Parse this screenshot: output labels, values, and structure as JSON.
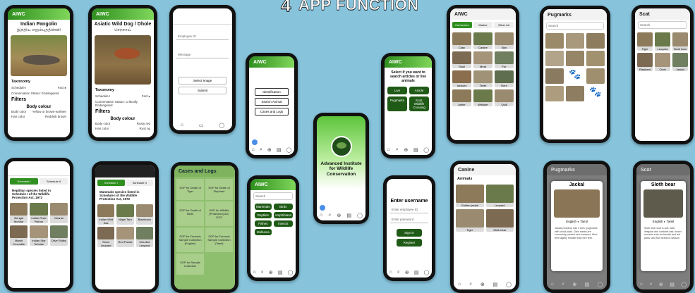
{
  "slide_title": {
    "number": "4",
    "text": "APP FUNCTION"
  },
  "app_name": "AIWC",
  "pangolin": {
    "name": "Indian Pangolin",
    "local_name": "இந்திய எறும்புத்தின்னி",
    "section": "Taxonomy",
    "rows": [
      [
        "Schedule I",
        "Fact ▸"
      ],
      [
        "Conservation Status: Endangered",
        ""
      ]
    ],
    "filters": "Filters",
    "body_colour": "Body colour",
    "attrs": [
      [
        "Body color",
        "Yellow or brown-earthen"
      ],
      [
        "Hair color",
        "Reddish brown"
      ]
    ]
  },
  "dhole": {
    "name": "Asiatic Wild Dog / Dhole",
    "local_name": "செந்நாய்",
    "section": "Taxonomy",
    "rows": [
      [
        "Schedule I",
        "Fact ▸"
      ],
      [
        "Conservation Status: Critically Endangered",
        ""
      ]
    ],
    "filters": "Filters",
    "body_colour": "Body colour",
    "attrs": [
      [
        "Body color",
        "Rusty red"
      ],
      [
        "Hair color",
        "Rust ng"
      ]
    ]
  },
  "report": {
    "fields": [
      "Employee ID",
      "Message"
    ],
    "buttons": [
      "Select Image",
      "Submit"
    ]
  },
  "menu": {
    "buttons": [
      "Identification",
      "Search Animal",
      "Cases and Logs"
    ]
  },
  "search_choice": {
    "prompt": "Select if you want to search articles or live animals",
    "buttons": [
      "Live",
      "Article",
      "Pugmarks",
      "Scat, Wildlife Crossing"
    ]
  },
  "splash": {
    "title": "Advanced Institute for Wildlife Conservation"
  },
  "article_grid": {
    "tabs": [
      "Carnivores",
      "Marine",
      "Other Art"
    ],
    "items": [
      "Claw",
      "Canine",
      "Skin",
      "Skull",
      "Meat",
      "Fur",
      "Incisors",
      "Teeth",
      "Horn",
      "Antler",
      "Whisker",
      "Quill"
    ]
  },
  "pugmarks": {
    "title": "Pugmarks",
    "search": "Search"
  },
  "scat": {
    "title": "Scat",
    "search": "Search",
    "items": [
      "Tiger",
      "Leopard",
      "Sloth bear",
      "Elephant",
      "Civet",
      "Jackal"
    ]
  },
  "schedule_list": {
    "tabs": [
      "Schedule I",
      "Schedule II"
    ],
    "header": "Reptilian species listed in Schedule I of the Wildlife Protection Act, 1972",
    "items": [
      "Bengal Monitor",
      "Indian Rock Python",
      "Gharial",
      "Marsh Crocodile",
      "Indian Star Tortoise",
      "Olive Ridley"
    ]
  },
  "mammal_list": {
    "tabs": [
      "Schedule I",
      "Schedule II"
    ],
    "header": "Mammals species listed in Schedule I of the Wildlife Protection Act, 1972",
    "items": [
      "Indian Wild Ass",
      "Nilgiri Tahr",
      "Blackbuck",
      "Snow Leopard",
      "Red Panda",
      "Clouded Leopard"
    ]
  },
  "cases": {
    "title": "Cases and Logs",
    "cells": [
      "SOP for Death of Tiger",
      "SOP for Death of Elephant",
      "SOP for Death of Birds",
      "SOP for Wildlife (Protection) Act, 2022",
      "SOP for Forensic Sample Collection (English)",
      "SOP for Forensic Sample Collection (Tamil)",
      "SOP for Sample Collection"
    ]
  },
  "category_list": {
    "search": "Search",
    "items": [
      "Mammals",
      "Birds",
      "Reptiles",
      "Amphibians",
      "Fishes",
      "Insects",
      "Mollusca"
    ]
  },
  "login": {
    "title": "Enter username",
    "fields": [
      "Enter employee ID",
      "Enter password"
    ],
    "buttons": [
      "Sign in",
      "Register"
    ]
  },
  "canine": {
    "title": "Canine",
    "section": "Animals",
    "items": [
      "Golden jackal",
      "Leopard",
      "Tiger",
      "Sloth bear"
    ]
  },
  "pug_detail": {
    "title": "Pugmarks",
    "animal": "Jackal",
    "toggle_left": "English",
    "toggle_right": "Tamil",
    "text": "Jackal (Golden) has 4 toes: pugmarks with ovoid pads. Claw marks are commonly present and compact. Hind feet slightly smaller than fore feet."
  },
  "scat_detail": {
    "title": "Scat",
    "animal": "Sloth bear",
    "toggle_left": "English",
    "toggle_right": "Tamil",
    "text": "Sloth bear scat is soft, dark, irregular and contains hair, insect remains such as termite and ant parts, and fruit seeds in season."
  }
}
